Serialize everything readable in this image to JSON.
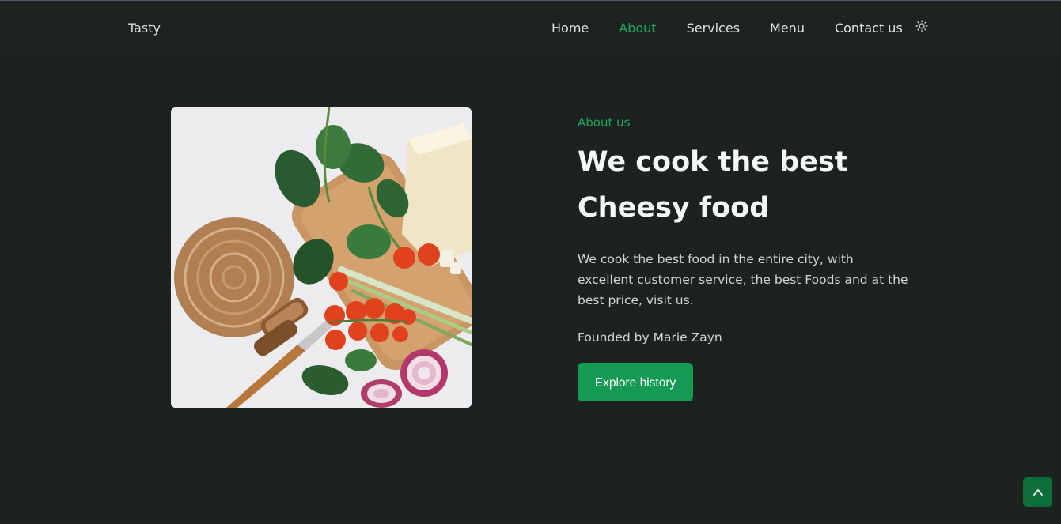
{
  "header": {
    "logo": "Tasty",
    "nav": [
      {
        "label": "Home"
      },
      {
        "label": "About",
        "active": true
      },
      {
        "label": "Services"
      },
      {
        "label": "Menu"
      },
      {
        "label": "Contact us"
      }
    ],
    "theme_toggle_icon": "sun-icon"
  },
  "about": {
    "subtitle": "About us",
    "title_line1": "We cook the best",
    "title_line2": "Cheesy food",
    "description": "We cook the best food in the entire city, with excellent customer service, the best Foods and at the best price, visit us.",
    "founder": "Founded by Marie Zayn",
    "button_label": "Explore history"
  },
  "scroll_top_icon": "chevron-up-icon",
  "colors": {
    "background": "#1c221f",
    "accent": "#1fa55d",
    "button": "#149a52",
    "scroll_button": "#0d6e3c"
  }
}
